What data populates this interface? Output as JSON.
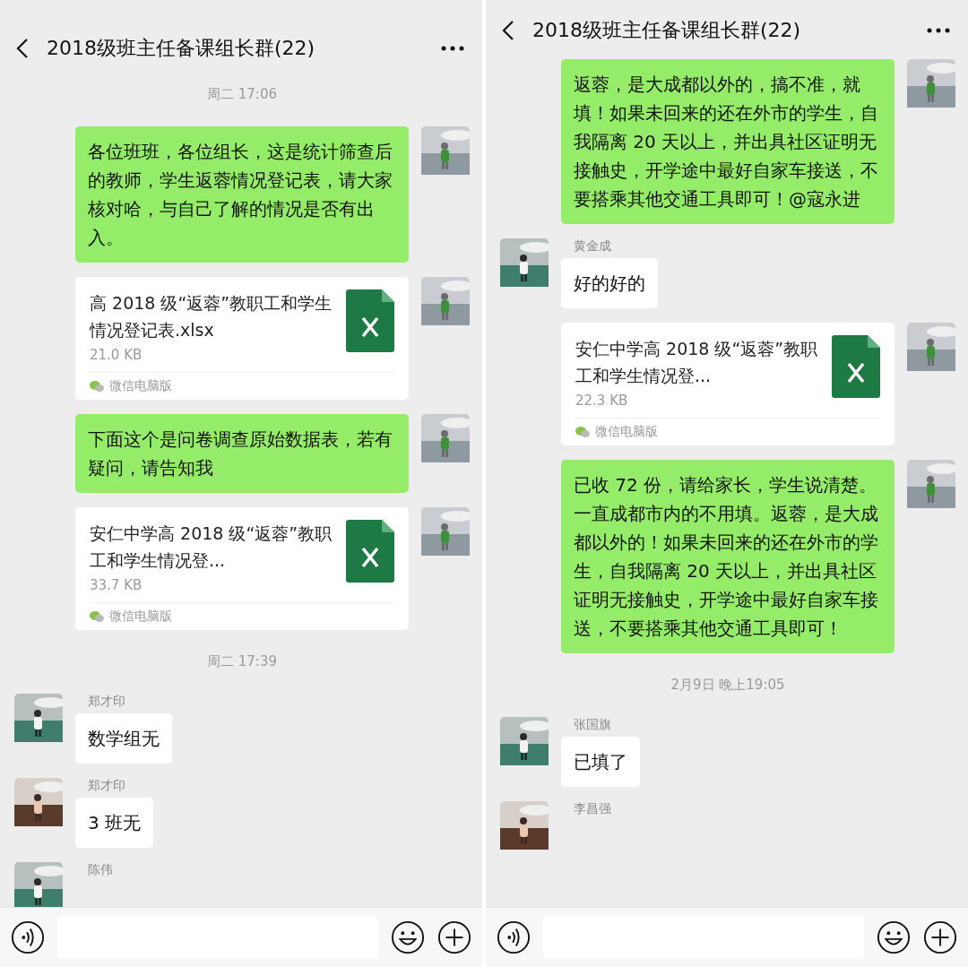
{
  "panels": [
    {
      "title": "2018级班主任备课组长群(22)",
      "messages": [
        {
          "kind": "time",
          "text": "周二 17:06"
        },
        {
          "kind": "text",
          "outgoing": true,
          "text": "各位班班，各位组长，这是统计筛查后的教师，学生返蓉情况登记表，请大家核对哈，与自己了解的情况是否有出入。"
        },
        {
          "kind": "file",
          "outgoing": true,
          "name": "高 2018 级“返蓉”教职工和学生情况登记表.xlsx",
          "size": "21.0 KB",
          "source": "微信电脑版"
        },
        {
          "kind": "text",
          "outgoing": true,
          "text": "下面这个是问卷调查原始数据表，若有疑问，请告知我"
        },
        {
          "kind": "file",
          "outgoing": true,
          "name": "安仁中学高 2018 级“返蓉”教职工和学生情况登...",
          "size": "33.7 KB",
          "source": "微信电脑版"
        },
        {
          "kind": "time",
          "text": "周二 17:39"
        },
        {
          "kind": "text",
          "outgoing": false,
          "sender": "郑才印",
          "text": "数学组无"
        },
        {
          "kind": "text",
          "outgoing": false,
          "sender": "郑才印",
          "text": "3 班无"
        },
        {
          "kind": "partial",
          "outgoing": false,
          "sender": "陈伟"
        }
      ]
    },
    {
      "title": "2018级班主任备课组长群(22)",
      "messages": [
        {
          "kind": "text",
          "outgoing": true,
          "text": "返蓉，是大成都以外的，搞不准，就填！如果未回来的还在外市的学生，自我隔离 20 天以上，并出具社区证明无接触史，开学途中最好自家车接送，不要搭乘其他交通工具即可！@寇永进"
        },
        {
          "kind": "text",
          "outgoing": false,
          "sender": "黄金成",
          "text": "好的好的"
        },
        {
          "kind": "file",
          "outgoing": true,
          "name": "安仁中学高 2018 级“返蓉”教职工和学生情况登...",
          "size": "22.3 KB",
          "source": "微信电脑版"
        },
        {
          "kind": "text",
          "outgoing": true,
          "text": "已收 72 份，请给家长，学生说清楚。一直成都市内的不用填。返蓉，是大成都以外的！如果未回来的还在外市的学生，自我隔离 20 天以上，并出具社区证明无接触史，开学途中最好自家车接送，不要搭乘其他交通工具即可！"
        },
        {
          "kind": "time",
          "text": "2月9日 晚上19:05"
        },
        {
          "kind": "text",
          "outgoing": false,
          "sender": "张国旗",
          "text": "已填了"
        },
        {
          "kind": "partial",
          "outgoing": false,
          "sender": "李昌强"
        }
      ]
    }
  ]
}
